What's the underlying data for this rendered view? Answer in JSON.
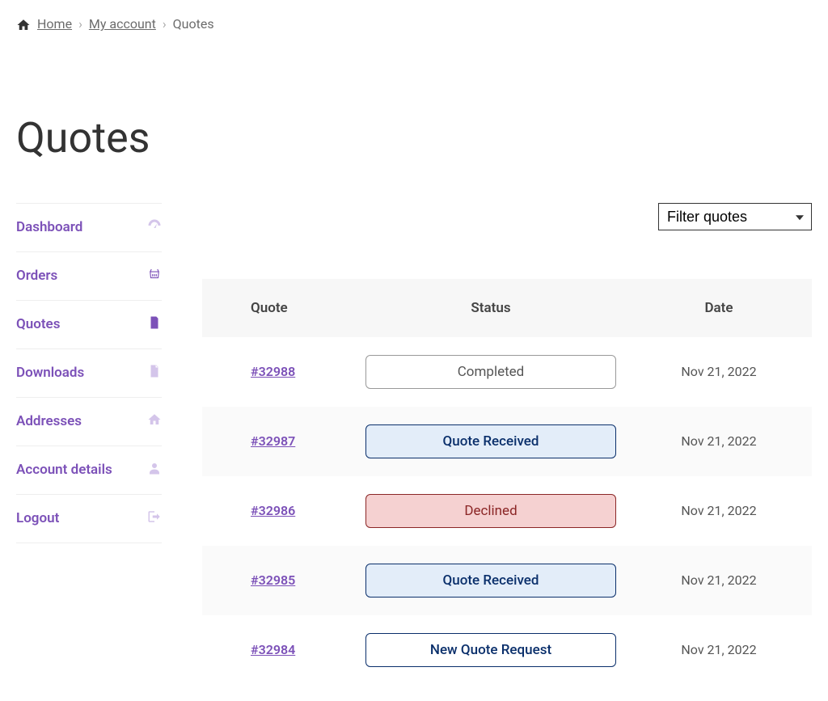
{
  "breadcrumb": {
    "home": "Home",
    "myaccount": "My account",
    "current": "Quotes"
  },
  "page_title": "Quotes",
  "sidebar": {
    "items": [
      {
        "label": "Dashboard",
        "icon": "dashboard",
        "active": false
      },
      {
        "label": "Orders",
        "icon": "basket",
        "active": false
      },
      {
        "label": "Quotes",
        "icon": "document",
        "active": true
      },
      {
        "label": "Downloads",
        "icon": "file",
        "active": false
      },
      {
        "label": "Addresses",
        "icon": "home",
        "active": false
      },
      {
        "label": "Account details",
        "icon": "user",
        "active": false
      },
      {
        "label": "Logout",
        "icon": "logout",
        "active": false
      }
    ]
  },
  "filter": {
    "label": "Filter quotes"
  },
  "table": {
    "headers": {
      "quote": "Quote",
      "status": "Status",
      "date": "Date"
    },
    "rows": [
      {
        "id": "#32988",
        "status": "Completed",
        "status_class": "completed",
        "date": "Nov 21, 2022"
      },
      {
        "id": "#32987",
        "status": "Quote Received",
        "status_class": "received",
        "date": "Nov 21, 2022"
      },
      {
        "id": "#32986",
        "status": "Declined",
        "status_class": "declined",
        "date": "Nov 21, 2022"
      },
      {
        "id": "#32985",
        "status": "Quote Received",
        "status_class": "received",
        "date": "Nov 21, 2022"
      },
      {
        "id": "#32984",
        "status": "New Quote Request",
        "status_class": "new",
        "date": "Nov 21, 2022"
      }
    ]
  }
}
